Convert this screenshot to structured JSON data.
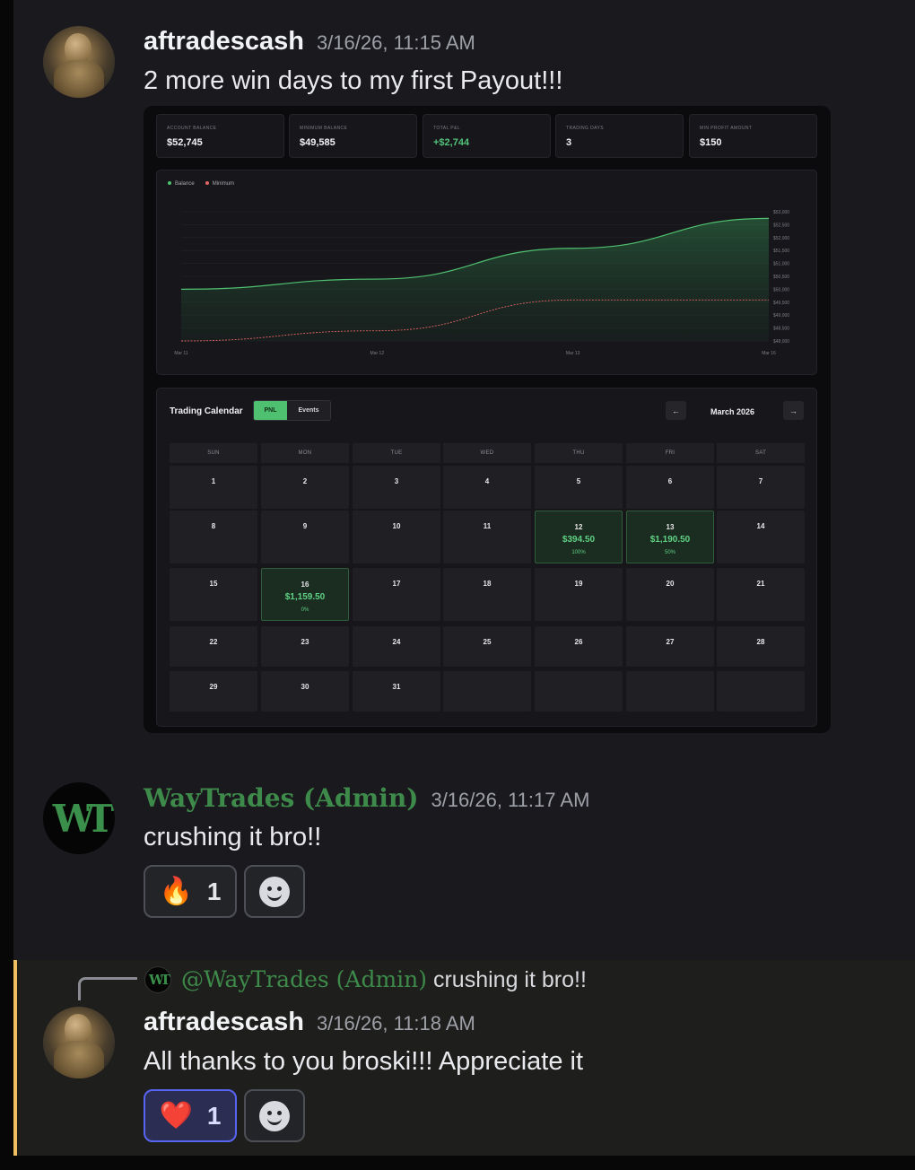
{
  "messages": [
    {
      "username": "aftradescash",
      "timestamp": "3/16/26, 11:15 AM",
      "text": "2 more win days to my first Payout!!!"
    },
    {
      "username": "WayTrades (Admin)",
      "timestamp": "3/16/26, 11:17 AM",
      "text": "crushing it bro!!",
      "avatar_text": "WT",
      "reactions": [
        {
          "emoji": "🔥",
          "count": "1",
          "active": false
        }
      ]
    },
    {
      "username": "aftradescash",
      "timestamp": "3/16/26, 11:18 AM",
      "text": "All thanks to you broski!!! Appreciate it",
      "reply_to": {
        "mention": "@WayTrades (Admin)",
        "text": "crushing it bro!!",
        "avatar_text": "WT"
      },
      "reactions": [
        {
          "emoji": "❤️",
          "count": "1",
          "active": true
        }
      ]
    }
  ],
  "dashboard": {
    "stats": [
      {
        "label": "ACCOUNT BALANCE",
        "value": "$52,745"
      },
      {
        "label": "MINIMUM BALANCE",
        "value": "$49,585"
      },
      {
        "label": "TOTAL P&L",
        "value": "+$2,744"
      },
      {
        "label": "TRADING DAYS",
        "value": "3"
      },
      {
        "label": "MIN PROFIT AMOUNT",
        "value": "$150"
      }
    ],
    "calendar": {
      "title": "Trading Calendar",
      "toggle_pnl": "PNL",
      "toggle_events": "Events",
      "month": "March 2026",
      "prev": "←",
      "next": "→",
      "weekdays": [
        "SUN",
        "MON",
        "TUE",
        "WED",
        "THU",
        "FRI",
        "SAT"
      ],
      "days": {
        "12": {
          "pnl": "$394.50",
          "pct": "100%"
        },
        "13": {
          "pnl": "$1,190.50",
          "pct": "50%"
        },
        "16": {
          "pnl": "$1,159.50",
          "pct": "0%"
        }
      }
    }
  },
  "chart_data": {
    "type": "area",
    "legend": [
      "Balance",
      "Minimum"
    ],
    "colors": {
      "Balance": "#4fc070",
      "Minimum": "#e06464"
    },
    "x": [
      "Mar 11",
      "Mar 12",
      "Mar 13",
      "Mar 16"
    ],
    "series": [
      {
        "name": "Balance",
        "values": [
          50000,
          50394.5,
          51585,
          52745
        ]
      },
      {
        "name": "Minimum",
        "values": [
          48000,
          48394.5,
          49585,
          49585
        ]
      }
    ],
    "y_ticks": [
      "$53,000",
      "$52,500",
      "$52,000",
      "$51,500",
      "$51,000",
      "$50,500",
      "$50,000",
      "$49,500",
      "$49,000",
      "$48,500",
      "$48,000"
    ],
    "ylim": [
      48000,
      53000
    ],
    "legend_position": "top-left"
  }
}
